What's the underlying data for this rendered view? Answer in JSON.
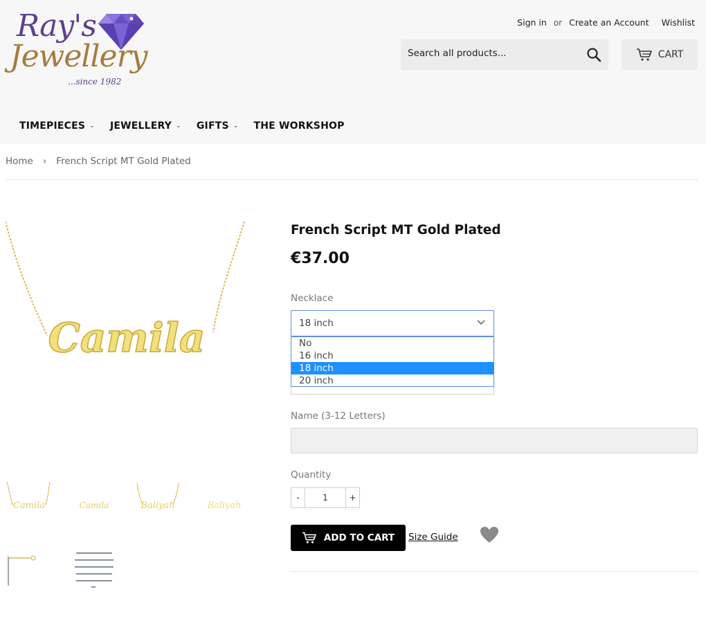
{
  "brand": {
    "line1": "Ray's",
    "line2": "Jewellery",
    "since": "...since 1982",
    "colors": {
      "purple": "#5c3f8f",
      "gold": "#a67c3d",
      "diamond": "#6a4fc4"
    }
  },
  "header": {
    "sign_in": "Sign in",
    "or": "or",
    "create_account": "Create an Account",
    "wishlist": "Wishlist",
    "search_placeholder": "Search all products...",
    "search_icon": "search-icon",
    "cart_label": "CART",
    "cart_icon": "cart-icon"
  },
  "nav": [
    {
      "label": "TIMEPIECES",
      "has_dropdown": true
    },
    {
      "label": "JEWELLERY",
      "has_dropdown": true
    },
    {
      "label": "GIFTS",
      "has_dropdown": true
    },
    {
      "label": "THE WORKSHOP",
      "has_dropdown": false
    }
  ],
  "breadcrumb": {
    "home": "Home",
    "separator": "›",
    "current": "French Script MT Gold Plated"
  },
  "product": {
    "title": "French Script MT Gold Plated",
    "price": "€37.00",
    "main_image_text": "Camila",
    "thumb_names": [
      "Camila",
      "Camila",
      "Baliyah",
      "Baliyah"
    ],
    "necklace_label": "Necklace",
    "necklace_selected": "18 inch",
    "necklace_options": [
      "No",
      "16 inch",
      "18 inch",
      "20 inch"
    ],
    "name_label": "Name (3-12 Letters)",
    "name_value": "",
    "quantity_label": "Quantity",
    "quantity_value": "1",
    "minus": "-",
    "plus": "+",
    "add_to_cart": "ADD TO CART",
    "size_guide": "Size Guide",
    "heart_icon": "heart-icon",
    "highlight_color": "#1e90ff"
  }
}
